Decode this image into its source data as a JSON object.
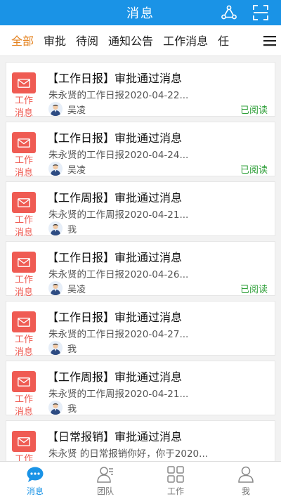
{
  "header": {
    "title": "消息"
  },
  "tabs": [
    {
      "label": "全部",
      "active": true
    },
    {
      "label": "审批",
      "active": false
    },
    {
      "label": "待阅",
      "active": false
    },
    {
      "label": "通知公告",
      "active": false
    },
    {
      "label": "工作消息",
      "active": false
    },
    {
      "label": "任",
      "active": false
    }
  ],
  "messages": [
    {
      "type": "工作消息",
      "title": "【工作日报】审批通过消息",
      "desc": "朱永贤的工作日报2020-04-22...",
      "user": "吴凌",
      "status": "已阅读"
    },
    {
      "type": "工作消息",
      "title": "【工作日报】审批通过消息",
      "desc": "朱永贤的工作日报2020-04-24...",
      "user": "吴凌",
      "status": "已阅读"
    },
    {
      "type": "工作消息",
      "title": "【工作周报】审批通过消息",
      "desc": "朱永贤的工作周报2020-04-21...",
      "user": "我",
      "status": ""
    },
    {
      "type": "工作消息",
      "title": "【工作日报】审批通过消息",
      "desc": "朱永贤的工作日报2020-04-26...",
      "user": "吴凌",
      "status": "已阅读"
    },
    {
      "type": "工作消息",
      "title": "【工作日报】审批通过消息",
      "desc": "朱永贤的工作日报2020-04-27...",
      "user": "我",
      "status": ""
    },
    {
      "type": "工作消息",
      "title": "【工作周报】审批通过消息",
      "desc": "朱永贤的工作周报2020-04-21...",
      "user": "我",
      "status": ""
    },
    {
      "type": "工作消息",
      "title": "【日常报销】审批通过消息",
      "desc": "朱永贤 的日常报销你好，你于2020...",
      "user": "",
      "status": ""
    }
  ],
  "bottom_nav": [
    {
      "label": "消息",
      "icon": "chat-icon",
      "active": true
    },
    {
      "label": "团队",
      "icon": "team-icon",
      "active": false
    },
    {
      "label": "工作",
      "icon": "grid-icon",
      "active": false
    },
    {
      "label": "我",
      "icon": "person-icon",
      "active": false
    }
  ],
  "colors": {
    "header_bg": "#1a93e6",
    "tab_active": "#e4821f",
    "message_accent": "#ef5b53",
    "status_read": "#31a03b",
    "nav_active": "#1a93e6"
  }
}
